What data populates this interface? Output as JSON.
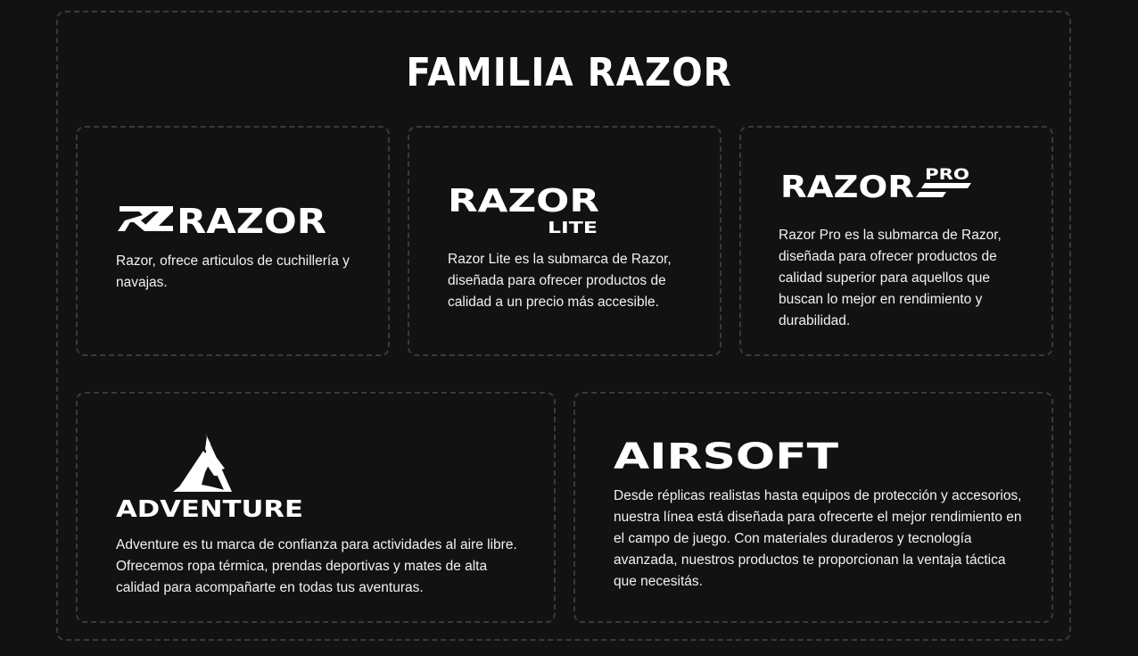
{
  "section": {
    "title": "FAMILIA RAZOR"
  },
  "cards": [
    {
      "logo_text": "RAZOR",
      "logo_icon": "rz-monogram",
      "description": "Razor, ofrece articulos de cuchillería y navajas."
    },
    {
      "logo_text": "RAZOR",
      "logo_subtext": "LITE",
      "description": "Razor Lite es la submarca de Razor, diseñada para ofrecer productos de calidad a un precio más accesible."
    },
    {
      "logo_text": "RAZOR",
      "logo_subtext": "PRO",
      "description": "Razor Pro es la submarca de Razor, diseñada para ofrecer productos de calidad superior para aquellos que buscan lo mejor en rendimiento y durabilidad."
    },
    {
      "logo_text": "ADVENTURE",
      "logo_icon": "mountain-icon",
      "description": "Adventure es tu marca de confianza para actividades al aire libre. Ofrecemos ropa térmica, prendas deportivas y mates de alta calidad para acompañarte en todas tus aventuras."
    },
    {
      "logo_text": "AIRSOFT",
      "description": "Desde réplicas realistas hasta equipos de protección y accesorios, nuestra línea está diseñada para ofrecerte el mejor rendimiento en el campo de juego. Con materiales duraderos y tecnología avanzada, nuestros productos te proporcionan la ventaja táctica que necesitás."
    }
  ],
  "colors": {
    "background": "#121212",
    "border": "#3a3a3a",
    "text": "#ffffff"
  }
}
